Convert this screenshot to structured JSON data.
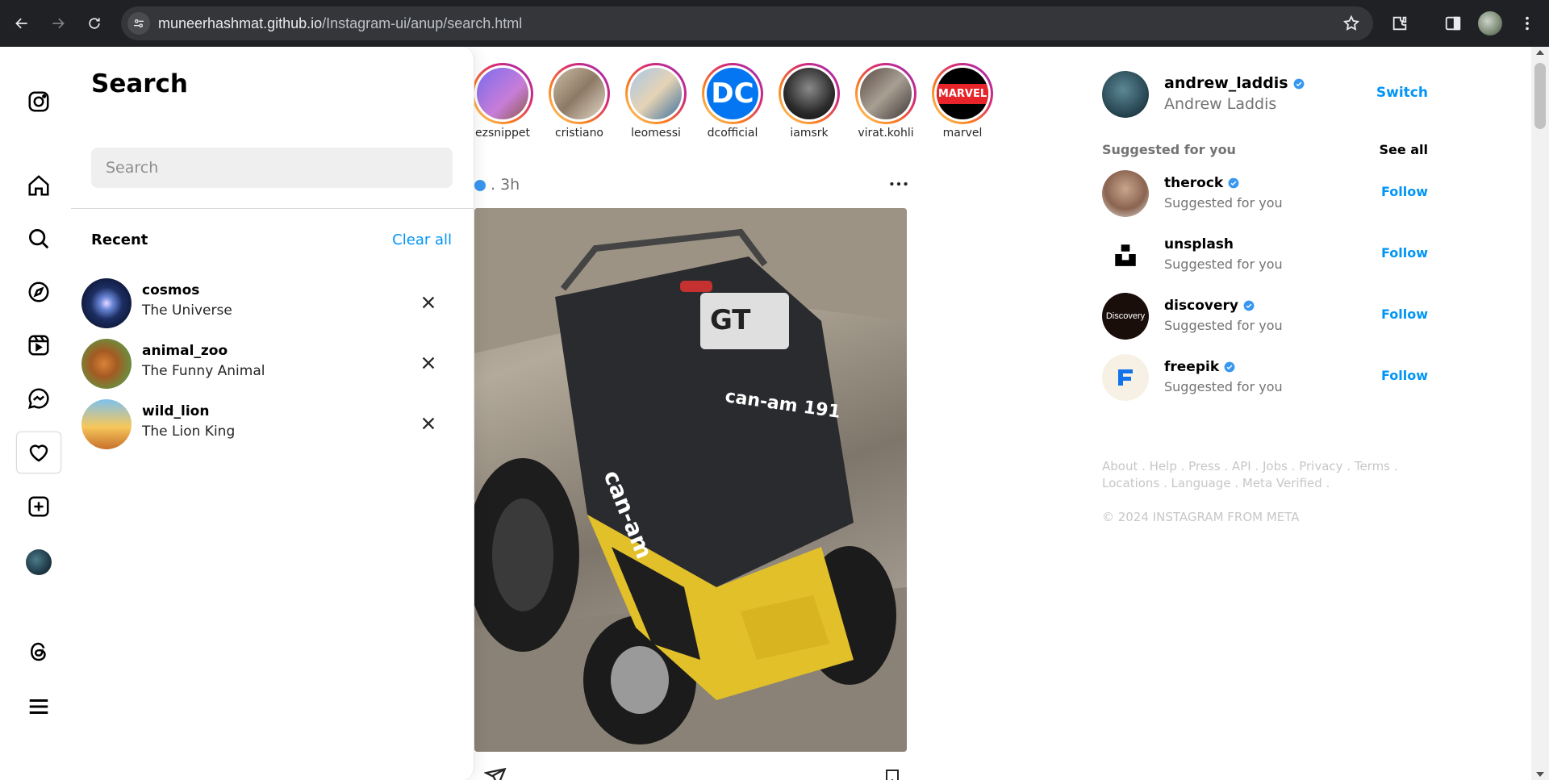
{
  "browser": {
    "url_host": "muneerhashmat.github.io",
    "url_path": "/Instagram-ui/anup/search.html"
  },
  "rail": {
    "icons": [
      "instagram-icon",
      "home-icon",
      "search-icon",
      "explore-icon",
      "reels-icon",
      "messenger-icon",
      "heart-icon",
      "create-icon",
      "profile-avatar",
      "threads-icon",
      "menu-icon"
    ]
  },
  "search": {
    "title": "Search",
    "placeholder": "Search",
    "recent_label": "Recent",
    "clear_all": "Clear all",
    "recent": [
      {
        "username": "cosmos",
        "fullname": "The Universe"
      },
      {
        "username": "animal_zoo",
        "fullname": "The Funny Animal"
      },
      {
        "username": "wild_lion",
        "fullname": "The Lion King"
      }
    ]
  },
  "stories": [
    {
      "label": "ezsnippet"
    },
    {
      "label": "cristiano"
    },
    {
      "label": "leomessi"
    },
    {
      "label": "dcofficial",
      "logo": "DC"
    },
    {
      "label": "iamsrk"
    },
    {
      "label": "virat.kohli"
    },
    {
      "label": "marvel",
      "logo": "MARVEL"
    }
  ],
  "post": {
    "time": ". 3h"
  },
  "sidebar_right": {
    "me": {
      "username": "andrew_laddis",
      "fullname": "Andrew Laddis",
      "switch": "Switch"
    },
    "suggested_label": "Suggested for you",
    "see_all": "See all",
    "suggestions": [
      {
        "username": "therock",
        "sub": "Suggested for you",
        "follow": "Follow",
        "verified": true
      },
      {
        "username": "unsplash",
        "sub": "Suggested for you",
        "follow": "Follow",
        "verified": false
      },
      {
        "username": "discovery",
        "sub": "Suggested for you",
        "follow": "Follow",
        "verified": true,
        "logo": "Discovery"
      },
      {
        "username": "freepik",
        "sub": "Suggested for you",
        "follow": "Follow",
        "verified": true
      }
    ],
    "footer_links_line1": "About . Help . Press . API . Jobs . Privacy . Terms .",
    "footer_links_line2": "Locations . Language . Meta Verified .",
    "copyright": "© 2024 INSTAGRAM FROM META"
  },
  "colors": {
    "accent": "#0095f6",
    "chrome_bg": "#202124"
  }
}
